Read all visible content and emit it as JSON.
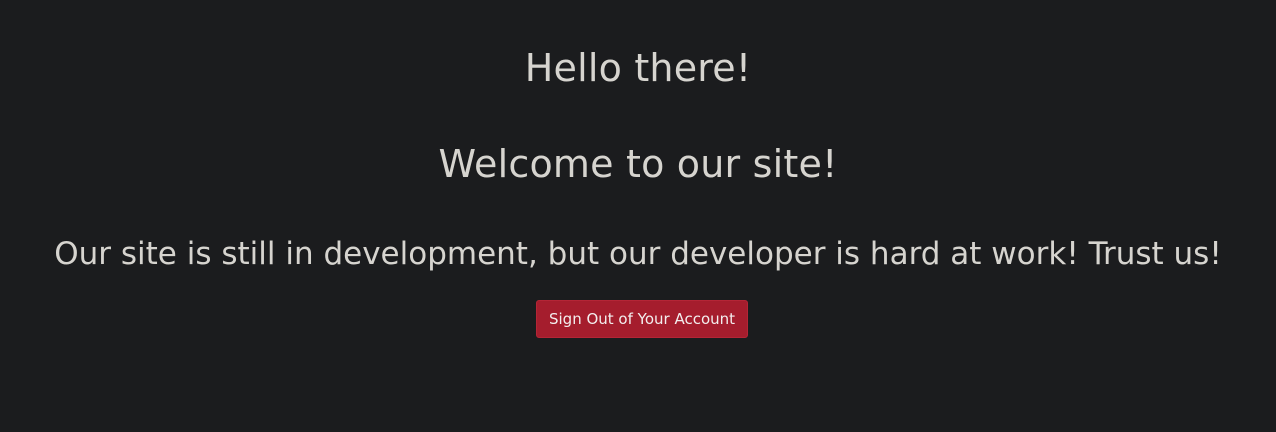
{
  "greeting": "Hello there!",
  "welcome": "Welcome to our site!",
  "notice": "Our site is still in development, but our developer is hard at work! Trust us!",
  "actions": {
    "sign_out_label": "Sign Out of Your Account"
  },
  "colors": {
    "background": "#1b1c1e",
    "text": "#d6d4cf",
    "danger_button": "#a51d2d"
  }
}
